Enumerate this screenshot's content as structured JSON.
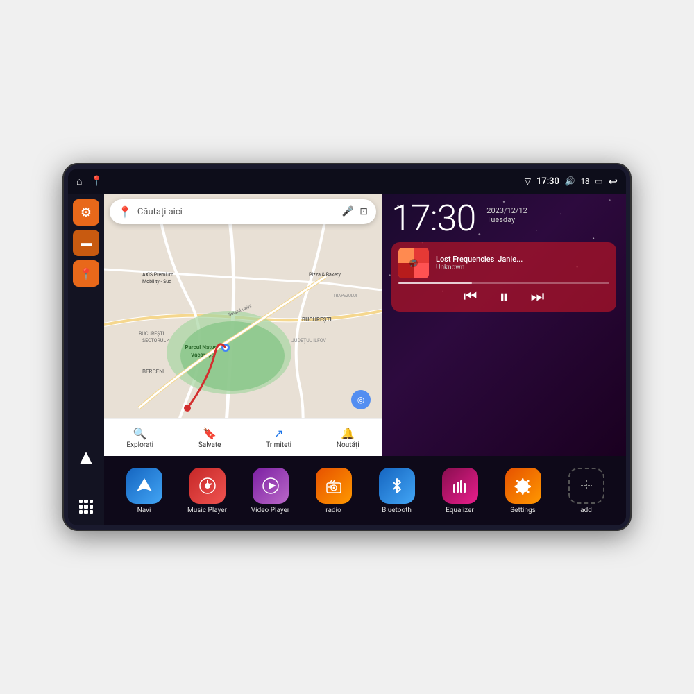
{
  "device": {
    "status_bar": {
      "wifi_icon": "▼",
      "time": "17:30",
      "volume_icon": "🔊",
      "battery_level": "18",
      "battery_icon": "🔋",
      "back_icon": "↩"
    },
    "sidebar": {
      "settings_label": "Settings",
      "folder_label": "Folder",
      "map_label": "Map",
      "nav_label": "Navigate",
      "grid_label": "All Apps"
    },
    "map": {
      "search_placeholder": "Căutați aici",
      "location_label": "Parcul Natural Văcărești",
      "axis_label": "AXIS Premium Mobility - Sud",
      "pizza_label": "Pizza & Bakery",
      "berceni_label": "BERCENI",
      "bucuresti_label": "BUCUREȘTI",
      "sectorul4_label": "BUCUREȘTI SECTORUL 4",
      "judetul_label": "JUDEȚUL ILFOV",
      "trapez_label": "TRAPEZULUI",
      "bottom_items": [
        {
          "icon": "📍",
          "label": "Explorați"
        },
        {
          "icon": "🔖",
          "label": "Salvate"
        },
        {
          "icon": "↗",
          "label": "Trimiteți"
        },
        {
          "icon": "🔔",
          "label": "Noutăți"
        }
      ]
    },
    "clock": {
      "time": "17:30",
      "date": "2023/12/12",
      "day": "Tuesday"
    },
    "music": {
      "title": "Lost Frequencies_Janie...",
      "artist": "Unknown",
      "prev_label": "previous",
      "pause_label": "pause",
      "next_label": "next"
    },
    "apps": [
      {
        "id": "navi",
        "label": "Navi",
        "icon": "▲",
        "color_class": "app-navi"
      },
      {
        "id": "music",
        "label": "Music Player",
        "icon": "♪",
        "color_class": "app-music"
      },
      {
        "id": "video",
        "label": "Video Player",
        "icon": "▶",
        "color_class": "app-video"
      },
      {
        "id": "radio",
        "label": "radio",
        "icon": "📻",
        "color_class": "app-radio"
      },
      {
        "id": "bluetooth",
        "label": "Bluetooth",
        "icon": "⚡",
        "color_class": "app-bluetooth"
      },
      {
        "id": "equalizer",
        "label": "Equalizer",
        "icon": "📊",
        "color_class": "app-eq"
      },
      {
        "id": "settings",
        "label": "Settings",
        "icon": "⚙",
        "color_class": "app-settings"
      },
      {
        "id": "add",
        "label": "add",
        "icon": "+",
        "color_class": "app-add"
      }
    ]
  }
}
